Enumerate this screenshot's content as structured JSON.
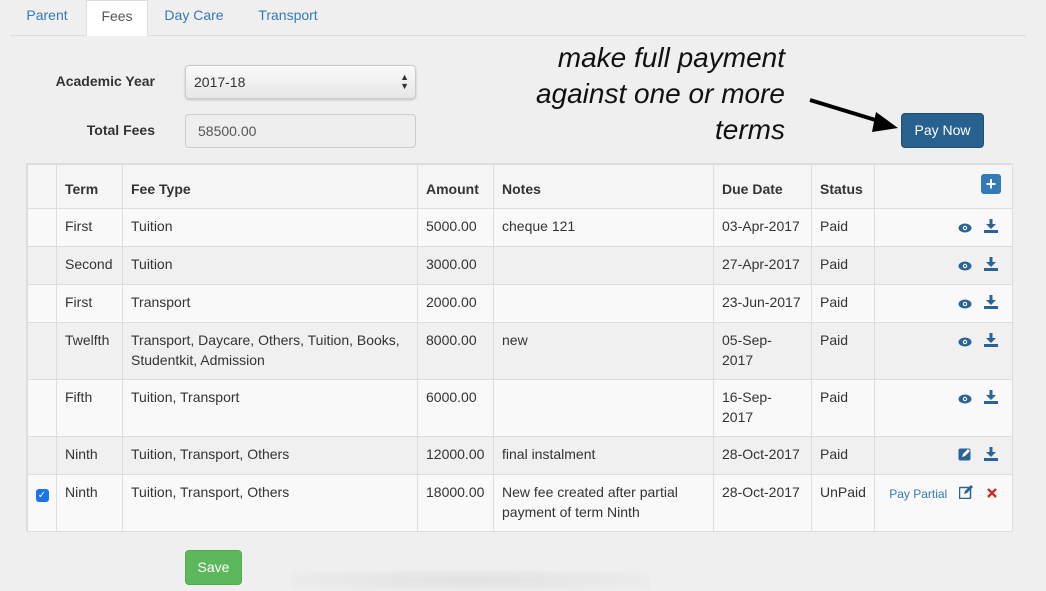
{
  "tabs": [
    {
      "label": "Parent",
      "active": false
    },
    {
      "label": "Fees",
      "active": true
    },
    {
      "label": "Day Care",
      "active": false
    },
    {
      "label": "Transport",
      "active": false
    }
  ],
  "form": {
    "academic_year_label": "Academic Year",
    "academic_year_value": "2017-18",
    "total_fees_label": "Total Fees",
    "total_fees_value": "58500.00"
  },
  "annotation": {
    "lines": [
      "make full payment",
      "against one or more",
      "terms"
    ]
  },
  "pay_now_label": "Pay Now",
  "table": {
    "headers": [
      "Term",
      "Fee Type",
      "Amount",
      "Notes",
      "Due Date",
      "Status"
    ],
    "rows": [
      {
        "checked": false,
        "term": "First",
        "fee_type": "Tuition",
        "amount": "5000.00",
        "notes": "cheque 121",
        "due_date": "03-Apr-2017",
        "status": "Paid",
        "actions": [
          "eye-icon",
          "download-icon"
        ]
      },
      {
        "checked": false,
        "term": "Second",
        "fee_type": "Tuition",
        "amount": "3000.00",
        "notes": "",
        "due_date": "27-Apr-2017",
        "status": "Paid",
        "actions": [
          "eye-icon",
          "download-icon"
        ]
      },
      {
        "checked": false,
        "term": "First",
        "fee_type": "Transport",
        "amount": "2000.00",
        "notes": "",
        "due_date": "23-Jun-2017",
        "status": "Paid",
        "actions": [
          "eye-icon",
          "download-icon"
        ]
      },
      {
        "checked": false,
        "term": "Twelfth",
        "fee_type": "Transport, Daycare, Others, Tuition, Books, Studentkit, Admission",
        "amount": "8000.00",
        "notes": "new",
        "due_date": "05-Sep-2017",
        "status": "Paid",
        "actions": [
          "eye-icon",
          "download-icon"
        ]
      },
      {
        "checked": false,
        "term": "Fifth",
        "fee_type": "Tuition, Transport",
        "amount": "6000.00",
        "notes": "",
        "due_date": "16-Sep-2017",
        "status": "Paid",
        "actions": [
          "eye-icon",
          "download-icon"
        ]
      },
      {
        "checked": false,
        "term": "Ninth",
        "fee_type": "Tuition, Transport, Others",
        "amount": "12000.00",
        "notes": "final instalment",
        "due_date": "28-Oct-2017",
        "status": "Paid",
        "actions": [
          "edit-icon",
          "download-icon"
        ]
      },
      {
        "checked": true,
        "term": "Ninth",
        "fee_type": "Tuition, Transport, Others",
        "amount": "18000.00",
        "notes": "New fee created after partial payment of term Ninth",
        "due_date": "28-Oct-2017",
        "status": "UnPaid",
        "pay_partial_label": "Pay Partial",
        "actions": [
          "edit-icon",
          "delete-icon"
        ]
      }
    ]
  },
  "save_label": "Save",
  "colors": {
    "link": "#337ab7",
    "primary_dark": "#286090",
    "success": "#5cb85c",
    "delete": "#c9302c",
    "checkbox": "#1a73e8"
  }
}
